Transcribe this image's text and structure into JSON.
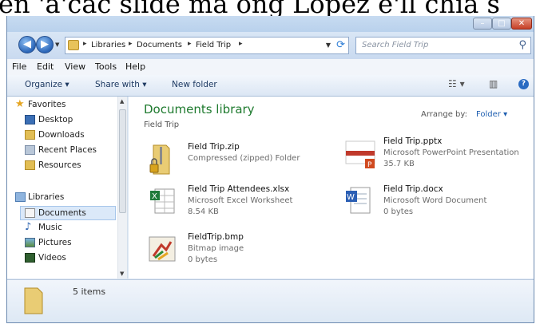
{
  "caption": {
    "text": "en 'a'cac slide ma ong Lopez e'll chia s"
  },
  "window": {
    "controls": {
      "minimize": "–",
      "maximize": "□",
      "close": "✕"
    }
  },
  "address": {
    "crumbs": [
      "Libraries",
      "Documents",
      "Field Trip"
    ],
    "separator": "▸",
    "search_placeholder": "Search Field Trip"
  },
  "menu": {
    "items": [
      "File",
      "Edit",
      "View",
      "Tools",
      "Help"
    ]
  },
  "toolbar": {
    "organize": "Organize ▾",
    "share_with": "Share with ▾",
    "new_folder": "New folder",
    "help": "?"
  },
  "navigation": {
    "favorites_header": "Favorites",
    "favorites": [
      "Desktop",
      "Downloads",
      "Recent Places",
      "Resources"
    ],
    "libraries_header": "Libraries",
    "libraries": [
      "Documents",
      "Music",
      "Pictures",
      "Videos"
    ],
    "selected": "Documents"
  },
  "library": {
    "title": "Documents library",
    "subtitle": "Field Trip",
    "arrange_label": "Arrange by:",
    "arrange_value": "Folder ▾"
  },
  "files": [
    {
      "name": "Field Trip.zip",
      "type": "Compressed (zipped) Folder",
      "size": "",
      "icon": "zip-folder-icon"
    },
    {
      "name": "Field Trip.pptx",
      "type": "Microsoft PowerPoint Presentation",
      "size": "35.7 KB",
      "icon": "powerpoint-file-icon"
    },
    {
      "name": "Field Trip Attendees.xlsx",
      "type": "Microsoft Excel Worksheet",
      "size": "8.54 KB",
      "icon": "excel-file-icon"
    },
    {
      "name": "Field Trip.docx",
      "type": "Microsoft Word Document",
      "size": "0 bytes",
      "icon": "word-file-icon"
    },
    {
      "name": "FieldTrip.bmp",
      "type": "Bitmap image",
      "size": "0 bytes",
      "icon": "bitmap-file-icon"
    }
  ],
  "details": {
    "count": "5 items"
  },
  "colors": {
    "library_title": "#1e7a2e",
    "link_blue": "#1f5fb0",
    "window_frame": "#dfe9f5"
  }
}
